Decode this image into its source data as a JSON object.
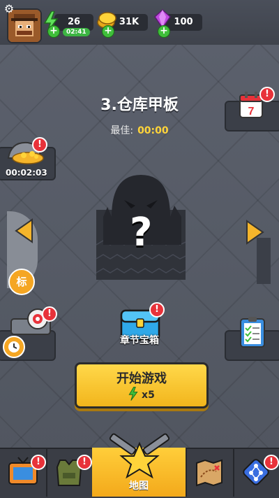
{
  "resources": {
    "energy": {
      "value": "26",
      "timer": "02:41"
    },
    "coins": {
      "value": "31K"
    },
    "gems": {
      "value": "100"
    }
  },
  "level": {
    "title": "3.仓库甲板",
    "best_label": "最佳:",
    "best_value": "00:00"
  },
  "widgets": {
    "treasure_timer": "00:02:03",
    "marker_label": "标",
    "chapter_chest_label": "章节宝箱",
    "mystery_mark": "?"
  },
  "start_button": {
    "label": "开始游戏",
    "cost": "x5"
  },
  "bottom_nav": {
    "map_label": "地图"
  },
  "colors": {
    "accent_yellow": "#f5c02b",
    "alert_red": "#e8323a",
    "energy_green": "#3fbf3a"
  }
}
